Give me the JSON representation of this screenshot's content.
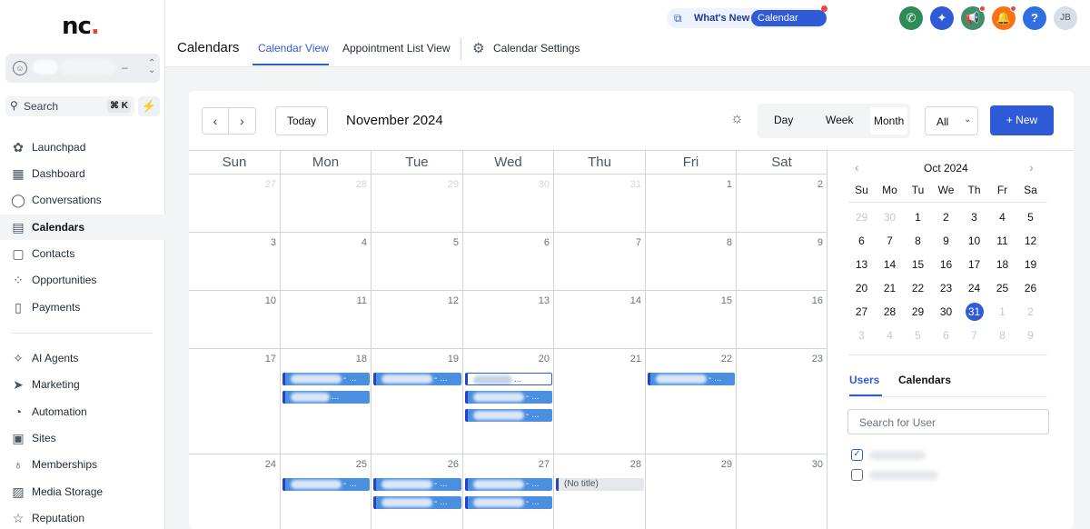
{
  "sidebar": {
    "logo": "nc",
    "search_label": "Search",
    "search_shortcut": "⌘ K",
    "items": [
      {
        "label": "Launchpad",
        "icon": "launchpad-icon"
      },
      {
        "label": "Dashboard",
        "icon": "dashboard-icon"
      },
      {
        "label": "Conversations",
        "icon": "chat-icon"
      },
      {
        "label": "Calendars",
        "icon": "calendar-icon"
      },
      {
        "label": "Contacts",
        "icon": "contacts-icon"
      },
      {
        "label": "Opportunities",
        "icon": "opportunities-icon"
      },
      {
        "label": "Payments",
        "icon": "payments-icon"
      },
      {
        "label": "AI Agents",
        "icon": "sparkle-icon"
      },
      {
        "label": "Marketing",
        "icon": "send-icon"
      },
      {
        "label": "Automation",
        "icon": "automation-icon"
      },
      {
        "label": "Sites",
        "icon": "sites-icon"
      },
      {
        "label": "Memberships",
        "icon": "memberships-icon"
      },
      {
        "label": "Media Storage",
        "icon": "image-icon"
      },
      {
        "label": "Reputation",
        "icon": "star-icon"
      }
    ],
    "active": "Calendars"
  },
  "topbar": {
    "whats_new": "What's New",
    "calendar_updates": "Calendar Updates",
    "avatar_initials": "JB",
    "help": "?",
    "page_title": "Calendars",
    "tabs": [
      "Calendar View",
      "Appointment List View",
      "Calendar Settings"
    ],
    "active_tab": "Calendar View",
    "colors": {
      "phone": "#2e8b57",
      "ai": "#2f5bd8",
      "announce": "#3f8f6a",
      "bell": "#f97316",
      "help": "#2f6fe0"
    }
  },
  "toolbar": {
    "today": "Today",
    "month_title": "November 2024",
    "views": [
      "Day",
      "Week",
      "Month"
    ],
    "active_view": "Month",
    "filter_value": "All",
    "new_label": "+ New"
  },
  "calendar": {
    "weekdays": [
      "Sun",
      "Mon",
      "Tue",
      "Wed",
      "Thu",
      "Fri",
      "Sat"
    ],
    "weeks": [
      [
        {
          "d": "27",
          "m": true
        },
        {
          "d": "28",
          "m": true
        },
        {
          "d": "29",
          "m": true
        },
        {
          "d": "30",
          "m": true
        },
        {
          "d": "31",
          "m": true
        },
        {
          "d": "1"
        },
        {
          "d": "2"
        }
      ],
      [
        {
          "d": "3"
        },
        {
          "d": "4"
        },
        {
          "d": "5"
        },
        {
          "d": "6"
        },
        {
          "d": "7"
        },
        {
          "d": "8"
        },
        {
          "d": "9"
        }
      ],
      [
        {
          "d": "10"
        },
        {
          "d": "11"
        },
        {
          "d": "12"
        },
        {
          "d": "13"
        },
        {
          "d": "14"
        },
        {
          "d": "15"
        },
        {
          "d": "16"
        }
      ],
      [
        {
          "d": "17"
        },
        {
          "d": "18"
        },
        {
          "d": "19"
        },
        {
          "d": "20"
        },
        {
          "d": "21"
        },
        {
          "d": "22"
        },
        {
          "d": "23"
        }
      ],
      [
        {
          "d": "24"
        },
        {
          "d": "25"
        },
        {
          "d": "26"
        },
        {
          "d": "27"
        },
        {
          "d": "28"
        },
        {
          "d": "29"
        },
        {
          "d": "30"
        }
      ]
    ],
    "events": [
      {
        "week": 3,
        "day": 1,
        "slot": 0,
        "text": "- ..."
      },
      {
        "week": 3,
        "day": 1,
        "slot": 1,
        "text": "..."
      },
      {
        "week": 3,
        "day": 2,
        "slot": 0,
        "text": "- ..."
      },
      {
        "week": 3,
        "day": 3,
        "slot": 0,
        "text": "...",
        "style": "outline"
      },
      {
        "week": 3,
        "day": 3,
        "slot": 1,
        "text": "- ..."
      },
      {
        "week": 3,
        "day": 3,
        "slot": 2,
        "text": "- ..."
      },
      {
        "week": 3,
        "day": 5,
        "slot": 0,
        "text": "- ..."
      },
      {
        "week": 4,
        "day": 1,
        "slot": 0,
        "text": "- ..."
      },
      {
        "week": 4,
        "day": 2,
        "slot": 0,
        "text": "- ..."
      },
      {
        "week": 4,
        "day": 2,
        "slot": 1,
        "text": "- ..."
      },
      {
        "week": 4,
        "day": 3,
        "slot": 0,
        "text": "- ..."
      },
      {
        "week": 4,
        "day": 3,
        "slot": 1,
        "text": "- ..."
      },
      {
        "week": 4,
        "day": 4,
        "slot": 0,
        "text": "(No title)",
        "style": "gray"
      }
    ]
  },
  "mini": {
    "title": "Oct 2024",
    "weekdays": [
      "Su",
      "Mo",
      "Tu",
      "We",
      "Th",
      "Fr",
      "Sa"
    ],
    "weeks": [
      [
        {
          "d": "29",
          "m": true
        },
        {
          "d": "30",
          "m": true
        },
        {
          "d": "1"
        },
        {
          "d": "2"
        },
        {
          "d": "3"
        },
        {
          "d": "4"
        },
        {
          "d": "5"
        }
      ],
      [
        {
          "d": "6"
        },
        {
          "d": "7"
        },
        {
          "d": "8"
        },
        {
          "d": "9"
        },
        {
          "d": "10"
        },
        {
          "d": "11"
        },
        {
          "d": "12"
        }
      ],
      [
        {
          "d": "13"
        },
        {
          "d": "14"
        },
        {
          "d": "15"
        },
        {
          "d": "16"
        },
        {
          "d": "17"
        },
        {
          "d": "18"
        },
        {
          "d": "19"
        }
      ],
      [
        {
          "d": "20"
        },
        {
          "d": "21"
        },
        {
          "d": "22"
        },
        {
          "d": "23"
        },
        {
          "d": "24"
        },
        {
          "d": "25"
        },
        {
          "d": "26"
        }
      ],
      [
        {
          "d": "27"
        },
        {
          "d": "28"
        },
        {
          "d": "29"
        },
        {
          "d": "30"
        },
        {
          "d": "31",
          "sel": true
        },
        {
          "d": "1",
          "m": true
        },
        {
          "d": "2",
          "m": true
        }
      ],
      [
        {
          "d": "3",
          "m": true
        },
        {
          "d": "4",
          "m": true
        },
        {
          "d": "5",
          "m": true
        },
        {
          "d": "6",
          "m": true
        },
        {
          "d": "7",
          "m": true
        },
        {
          "d": "8",
          "m": true
        },
        {
          "d": "9",
          "m": true
        }
      ]
    ]
  },
  "panel": {
    "tabs": [
      "Users",
      "Calendars"
    ],
    "active_tab": "Users",
    "search_placeholder": "Search for User",
    "users": [
      {
        "checked": true
      },
      {
        "checked": false
      }
    ]
  }
}
